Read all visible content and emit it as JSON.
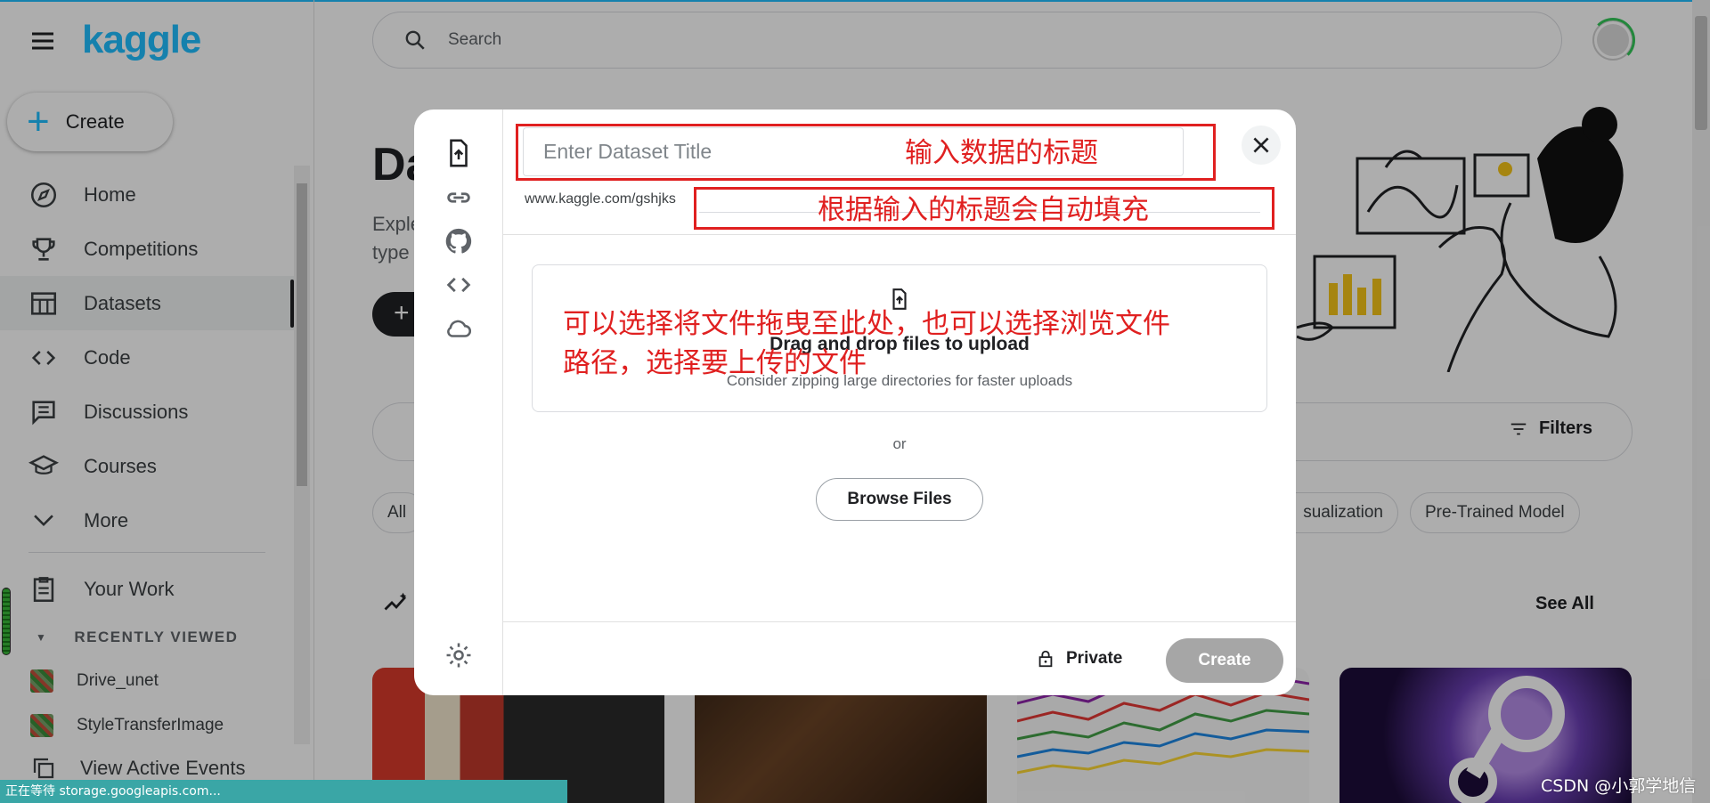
{
  "app": {
    "logo": "kaggle",
    "create_label": "Create"
  },
  "search": {
    "placeholder": "Search"
  },
  "sidebar": {
    "items": [
      {
        "label": "Home",
        "icon": "compass-icon"
      },
      {
        "label": "Competitions",
        "icon": "trophy-icon"
      },
      {
        "label": "Datasets",
        "icon": "table-icon",
        "active": true
      },
      {
        "label": "Code",
        "icon": "code-icon"
      },
      {
        "label": "Discussions",
        "icon": "discussion-icon"
      },
      {
        "label": "Courses",
        "icon": "school-icon"
      },
      {
        "label": "More",
        "icon": "chevron-down-icon"
      }
    ],
    "your_work": "Your Work",
    "recently_viewed": "RECENTLY VIEWED",
    "recent": [
      "Drive_unet",
      "StyleTransferImage"
    ],
    "active_events": "View Active Events"
  },
  "background": {
    "title": "Da",
    "desc_lines": [
      "Exple",
      "type"
    ],
    "new_btn": "+",
    "filters": "Filters",
    "chips": [
      "All",
      "sualization",
      "Pre-Trained Model"
    ],
    "see_all": "See All"
  },
  "dialog": {
    "title_placeholder": "Enter Dataset Title",
    "url_prefix": "www.kaggle.com/gshjks",
    "dropzone_title": "Drag and drop files to upload",
    "dropzone_sub": "Consider zipping large directories for faster uploads",
    "or": "or",
    "browse": "Browse Files",
    "privacy": "Private",
    "create": "Create"
  },
  "annotations": {
    "title_note": "输入数据的标题",
    "url_note": "根据输入的标题会自动填充",
    "upload_note_line1": "可以选择将文件拖曳至此处，也可以选择浏览文件",
    "upload_note_line2": "路径，选择要上传的文件"
  },
  "status": {
    "text": "正在等待 storage.googleapis.com..."
  },
  "watermark": "CSDN @小郭学地信",
  "colors": {
    "brand": "#20beff",
    "annotation": "#e02020",
    "create_disabled": "#a6a6a6",
    "status_bar": "#3aa6a6"
  }
}
